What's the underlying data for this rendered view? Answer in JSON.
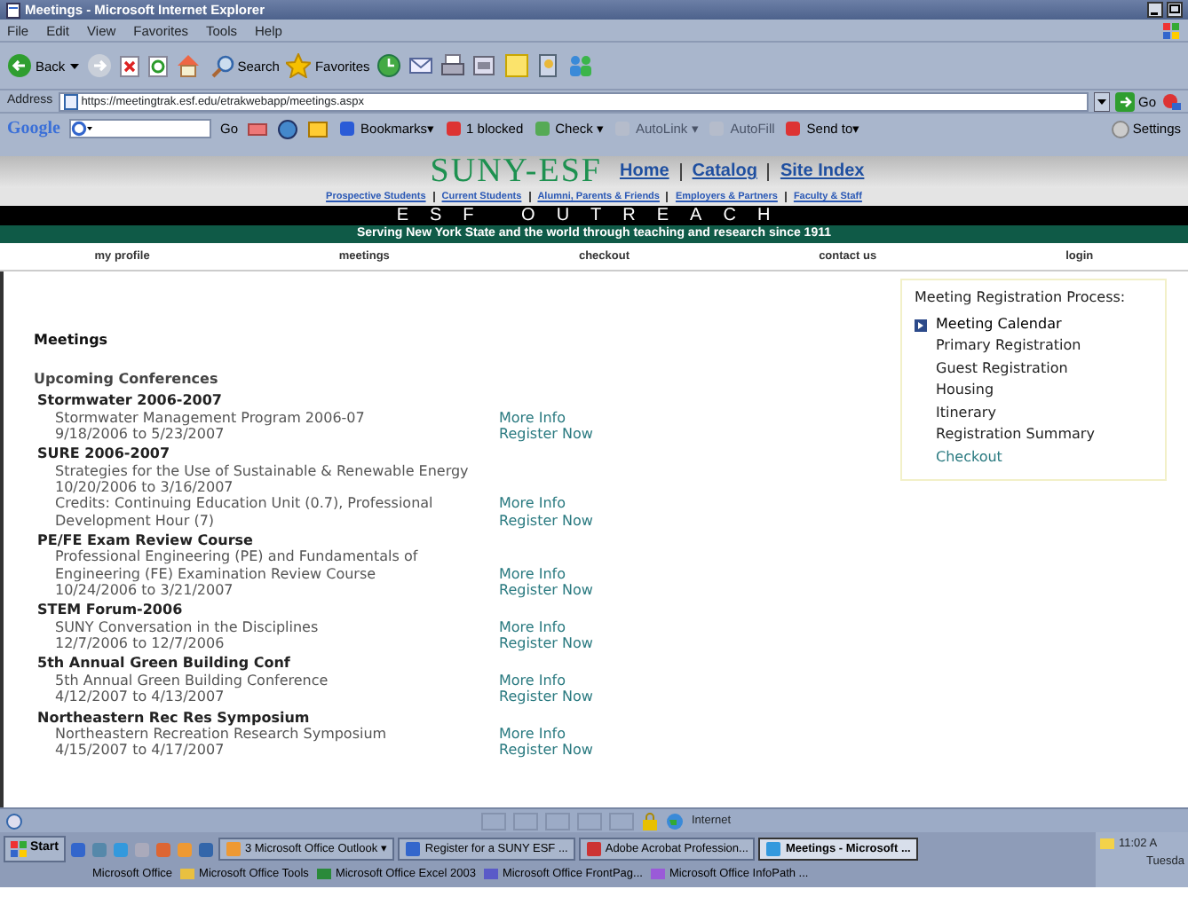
{
  "window": {
    "title": "Meetings - Microsoft Internet Explorer"
  },
  "menu": [
    "File",
    "Edit",
    "View",
    "Favorites",
    "Tools",
    "Help"
  ],
  "toolbar": {
    "back": "Back",
    "search": "Search",
    "favorites": "Favorites"
  },
  "address_bar": {
    "label": "Address",
    "value": "https://meetingtrak.esf.edu/etrakwebapp/meetings.aspx",
    "go": "Go"
  },
  "google_toolbar": {
    "logo": "Google",
    "go": "Go",
    "items": [
      {
        "label": "Bookmarks▾",
        "disabled": false
      },
      {
        "label": "1 blocked",
        "disabled": false
      },
      {
        "label": "Check ▾",
        "disabled": false
      },
      {
        "label": "AutoLink ▾",
        "disabled": true
      },
      {
        "label": "AutoFill",
        "disabled": true
      },
      {
        "label": "Send to▾",
        "disabled": false
      }
    ],
    "settings": "Settings"
  },
  "site": {
    "logo": "SUNY-ESF",
    "top_links": [
      "Home",
      "Catalog",
      "Site Index"
    ],
    "audience_links": [
      "Prospective Students",
      "Current Students",
      "Alumni, Parents & Friends",
      "Employers & Partners",
      "Faculty & Staff"
    ],
    "banner": "ESF OUTREACH",
    "tagline": "Serving New York State and the world through teaching and research since 1911",
    "nav": [
      "my profile",
      "meetings",
      "checkout",
      "contact us",
      "login"
    ]
  },
  "content": {
    "heading": "Meetings",
    "subheading": "Upcoming Conferences",
    "conferences": [
      {
        "title": "Stormwater 2006-2007",
        "lines": [
          "Stormwater Management Program 2006-07",
          "9/18/2006 to 5/23/2007"
        ],
        "links": [
          "More Info",
          "Register Now"
        ]
      },
      {
        "title": "SURE 2006-2007",
        "lines": [
          "Strategies for the Use of Sustainable & Renewable Energy",
          "10/20/2006 to 3/16/2007",
          "Credits: Continuing Education Unit (0.7), Professional Development Hour (7)"
        ],
        "links": [
          "More Info",
          "Register Now"
        ]
      },
      {
        "title": "PE/FE Exam Review Course",
        "lines": [
          "Professional Engineering (PE) and Fundamentals of Engineering (FE) Examination Review Course",
          "10/24/2006 to 3/21/2007"
        ],
        "links": [
          "More Info",
          "Register Now"
        ]
      },
      {
        "title": "STEM Forum-2006",
        "lines": [
          "SUNY Conversation in the Disciplines",
          "12/7/2006 to 12/7/2006"
        ],
        "links": [
          "More Info",
          "Register Now"
        ]
      },
      {
        "title": "5th Annual Green Building Conf",
        "lines": [
          "5th Annual Green Building Conference",
          "4/12/2007 to 4/13/2007"
        ],
        "links": [
          "More Info",
          "Register Now"
        ]
      },
      {
        "title": "Northeastern Rec Res Symposium",
        "lines": [
          "Northeastern Recreation Research Symposium",
          "4/15/2007 to 4/17/2007"
        ],
        "links": [
          "More Info",
          "Register Now"
        ]
      }
    ]
  },
  "process": {
    "title": "Meeting Registration Process:",
    "steps": [
      {
        "label": "Meeting Calendar",
        "selected": true,
        "kind": "text"
      },
      {
        "label": "Primary Registration",
        "selected": false,
        "kind": "text"
      },
      {
        "label": "Guest Registration",
        "selected": false,
        "kind": "text"
      },
      {
        "label": "Housing",
        "selected": false,
        "kind": "text"
      },
      {
        "label": "Itinerary",
        "selected": false,
        "kind": "text"
      },
      {
        "label": "Registration Summary",
        "selected": false,
        "kind": "text"
      },
      {
        "label": "Checkout",
        "selected": false,
        "kind": "link"
      }
    ]
  },
  "status_bar": {
    "zone": "Internet"
  },
  "taskbar": {
    "start": "Start",
    "tasks": [
      {
        "label": "3 Microsoft Office Outlook ▾",
        "selected": false
      },
      {
        "label": "Register for a SUNY ESF ...",
        "selected": false
      },
      {
        "label": "Adobe Acrobat Profession...",
        "selected": false
      },
      {
        "label": "Meetings - Microsoft ...",
        "selected": true
      }
    ],
    "toolbars": [
      "Microsoft Office",
      "Microsoft Office Tools",
      "Microsoft Office Excel 2003",
      "Microsoft Office FrontPag...",
      "Microsoft Office InfoPath ..."
    ],
    "clock": "11:02 A",
    "date": "Tuesda"
  }
}
